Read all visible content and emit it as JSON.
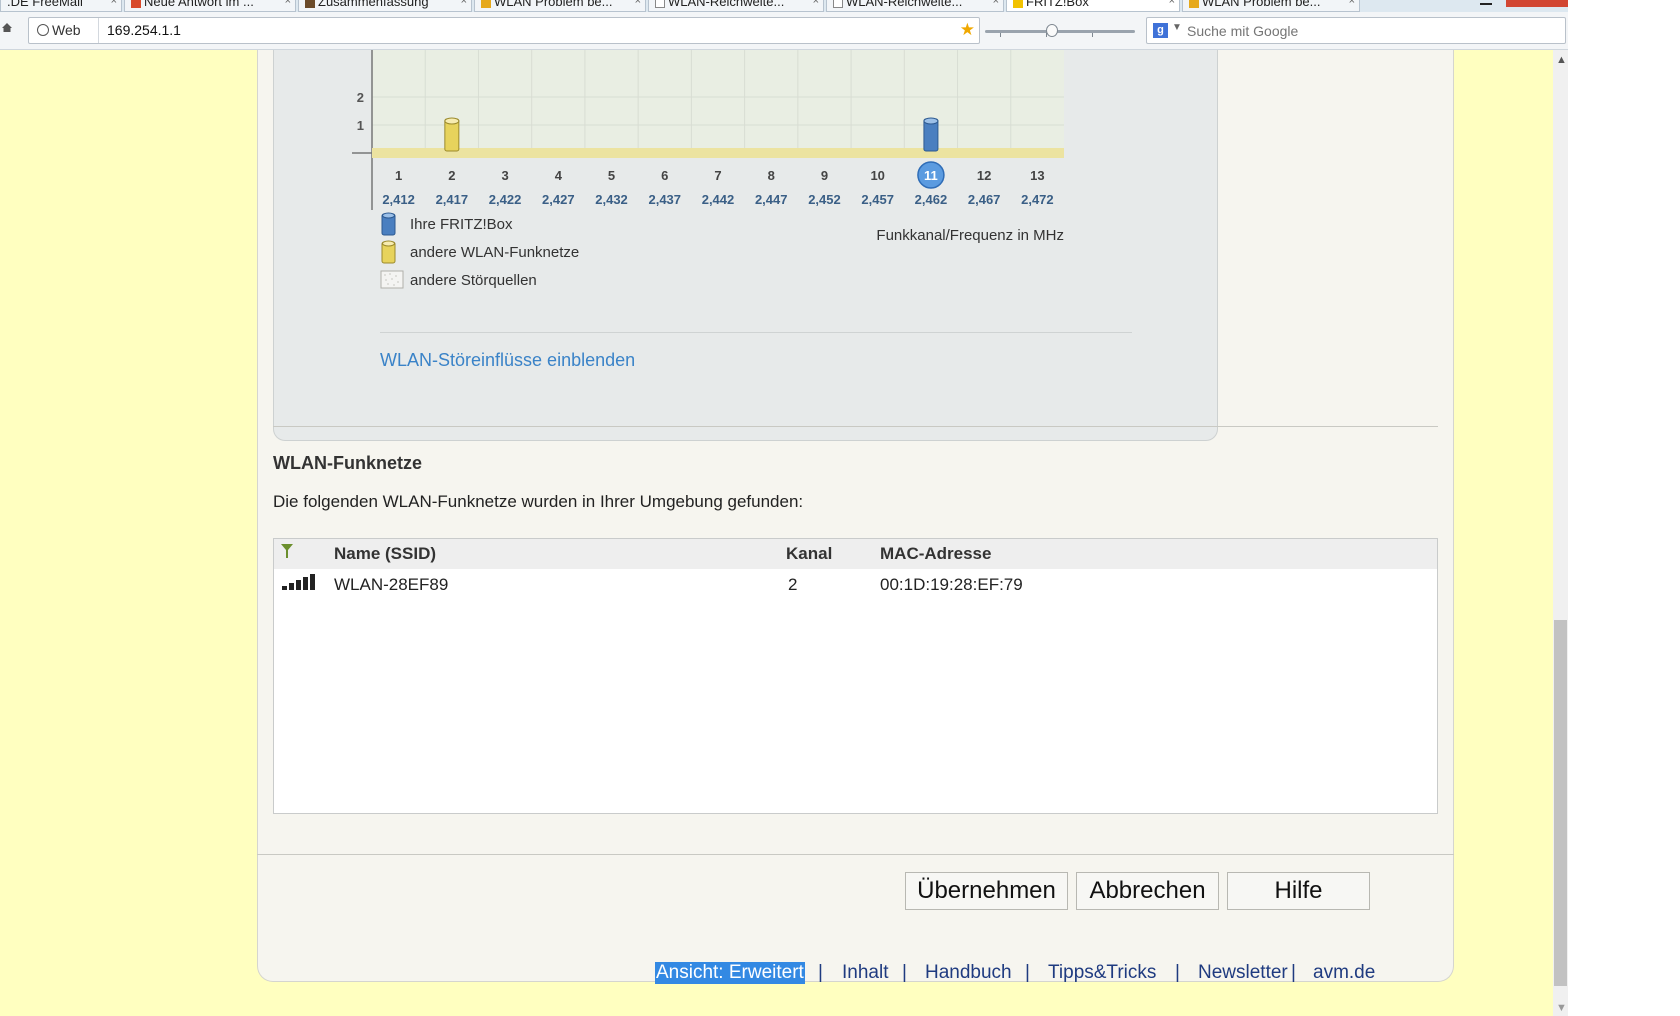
{
  "browser": {
    "tabs": [
      {
        "label": ".DE FreeMail"
      },
      {
        "label": "Neue Antwort im ..."
      },
      {
        "label": "Zusammenfassung"
      },
      {
        "label": "WLAN Problem be..."
      },
      {
        "label": "WLAN-Reichweite..."
      },
      {
        "label": "WLAN-Reichweite..."
      },
      {
        "label": "FRITZ!Box"
      },
      {
        "label": "WLAN Problem be..."
      }
    ],
    "identity_label": "Web",
    "url": "169.254.1.1",
    "search_placeholder": "Suche mit Google"
  },
  "chart_data": {
    "type": "bar",
    "xlabel": "Funkkanal/Frequenz in MHz",
    "y_ticks": [
      "2",
      "1"
    ],
    "categories": [
      "1",
      "2",
      "3",
      "4",
      "5",
      "6",
      "7",
      "8",
      "9",
      "10",
      "11",
      "12",
      "13"
    ],
    "frequencies": [
      "2,412",
      "2,417",
      "2,422",
      "2,427",
      "2,432",
      "2,437",
      "2,442",
      "2,447",
      "2,452",
      "2,457",
      "2,462",
      "2,467",
      "2,472"
    ],
    "series": [
      {
        "name": "Ihre FRITZ!Box",
        "color": "#4a7fc0",
        "values": [
          0,
          0,
          0,
          0,
          0,
          0,
          0,
          0,
          0,
          0,
          1,
          0,
          0
        ]
      },
      {
        "name": "andere WLAN-Funknetze",
        "color": "#e7d35c",
        "values": [
          0,
          1,
          0,
          0,
          0,
          0,
          0,
          0,
          0,
          0,
          0,
          0,
          0
        ]
      }
    ],
    "highlighted_channel": "11",
    "legend": [
      {
        "label": "Ihre FRITZ!Box",
        "icon": "blue-cylinder-icon"
      },
      {
        "label": "andere WLAN-Funknetze",
        "icon": "yellow-cylinder-icon"
      },
      {
        "label": "andere Störquellen",
        "icon": "interference-pattern-icon"
      }
    ]
  },
  "chart_link": "WLAN-Störeinflüsse einblenden",
  "networks": {
    "title": "WLAN-Funknetze",
    "description": "Die folgenden WLAN-Funknetze wurden in Ihrer Umgebung gefunden:",
    "columns": {
      "name": "Name (SSID)",
      "channel": "Kanal",
      "mac": "MAC-Adresse"
    },
    "rows": [
      {
        "signal_level": 5,
        "signal_max": 5,
        "name": "WLAN-28EF89",
        "channel": "2",
        "mac": "00:1D:19:28:EF:79"
      }
    ]
  },
  "buttons": {
    "apply": "Übernehmen",
    "cancel": "Abbrechen",
    "help": "Hilfe"
  },
  "footer": {
    "view": "Ansicht: Erweitert",
    "content": "Inhalt",
    "manual": "Handbuch",
    "tips": "Tipps&Tricks",
    "newsletter": "Newsletter",
    "avm": "avm.de",
    "separator": "|"
  }
}
